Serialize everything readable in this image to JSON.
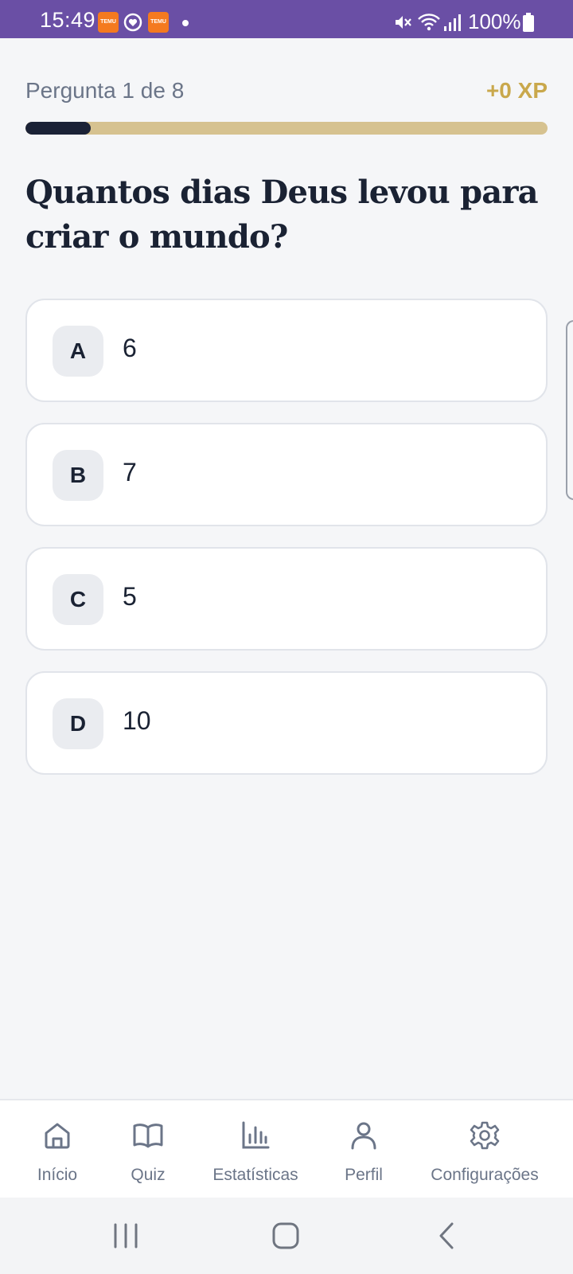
{
  "status_bar": {
    "time": "15:49",
    "badge_text": "TEMU",
    "battery": "100%"
  },
  "quiz": {
    "counter": "Pergunta 1 de 8",
    "xp": "+0 XP",
    "progress": 0.125,
    "question": "Quantos dias Deus levou para criar o mundo?",
    "options": [
      {
        "letter": "A",
        "text": "6"
      },
      {
        "letter": "B",
        "text": "7"
      },
      {
        "letter": "C",
        "text": "5"
      },
      {
        "letter": "D",
        "text": "10"
      }
    ]
  },
  "bottom_nav": {
    "items": [
      {
        "label": "Início",
        "icon": "home-icon"
      },
      {
        "label": "Quiz",
        "icon": "book-icon"
      },
      {
        "label": "Estatísticas",
        "icon": "bar-chart-icon"
      },
      {
        "label": "Perfil",
        "icon": "user-icon"
      },
      {
        "label": "Configurações",
        "icon": "gear-icon"
      }
    ]
  },
  "colors": {
    "status_bar": "#6a4fa5",
    "accent_gold": "#c9a84c",
    "progress_track": "#d6c290",
    "progress_fill": "#1b2236"
  }
}
